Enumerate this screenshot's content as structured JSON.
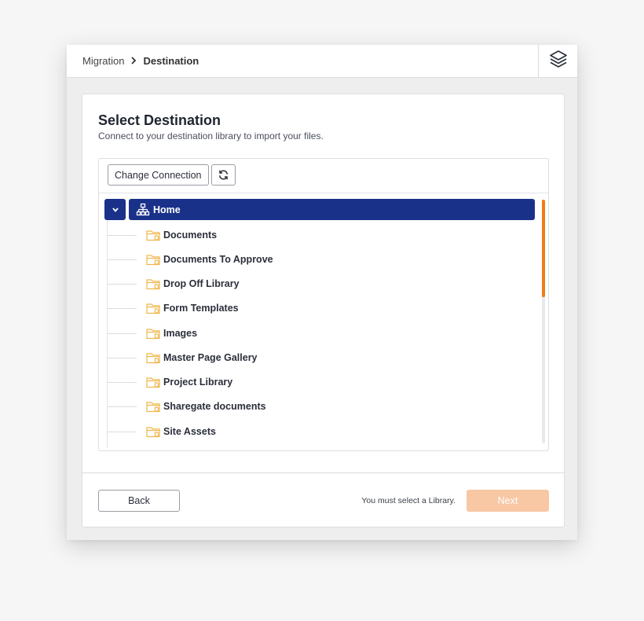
{
  "breadcrumb": {
    "items": [
      "Migration",
      "Destination"
    ],
    "separator": "›"
  },
  "header": {
    "menu_icon": "layers-icon"
  },
  "main": {
    "title": "Select Destination",
    "subtitle": "Connect to your destination library to import your files.",
    "toolbar": {
      "change_connection_label": "Change Connection",
      "refresh_icon": "refresh-icon"
    },
    "tree": {
      "root": {
        "label": "Home",
        "icon": "site-hierarchy-icon",
        "expanded": true,
        "selected": true
      },
      "children": [
        {
          "label": "Documents",
          "icon": "library-folder-icon"
        },
        {
          "label": "Documents To Approve",
          "icon": "library-folder-icon"
        },
        {
          "label": "Drop Off Library",
          "icon": "library-folder-icon"
        },
        {
          "label": "Form Templates",
          "icon": "library-folder-icon"
        },
        {
          "label": "Images",
          "icon": "library-folder-icon"
        },
        {
          "label": "Master Page Gallery",
          "icon": "library-folder-icon"
        },
        {
          "label": "Project Library",
          "icon": "library-folder-icon"
        },
        {
          "label": "Sharegate documents",
          "icon": "library-folder-icon"
        },
        {
          "label": "Site Assets",
          "icon": "library-folder-icon"
        }
      ]
    }
  },
  "footer": {
    "back_label": "Back",
    "validation_message": "You must select a Library.",
    "next_label": "Next",
    "next_disabled": true
  },
  "colors": {
    "selection": "#1a3189",
    "scrollbar_thumb": "#f07b17",
    "next_button_disabled": "#f8c7a3",
    "folder_icon": "#f0b64a"
  }
}
